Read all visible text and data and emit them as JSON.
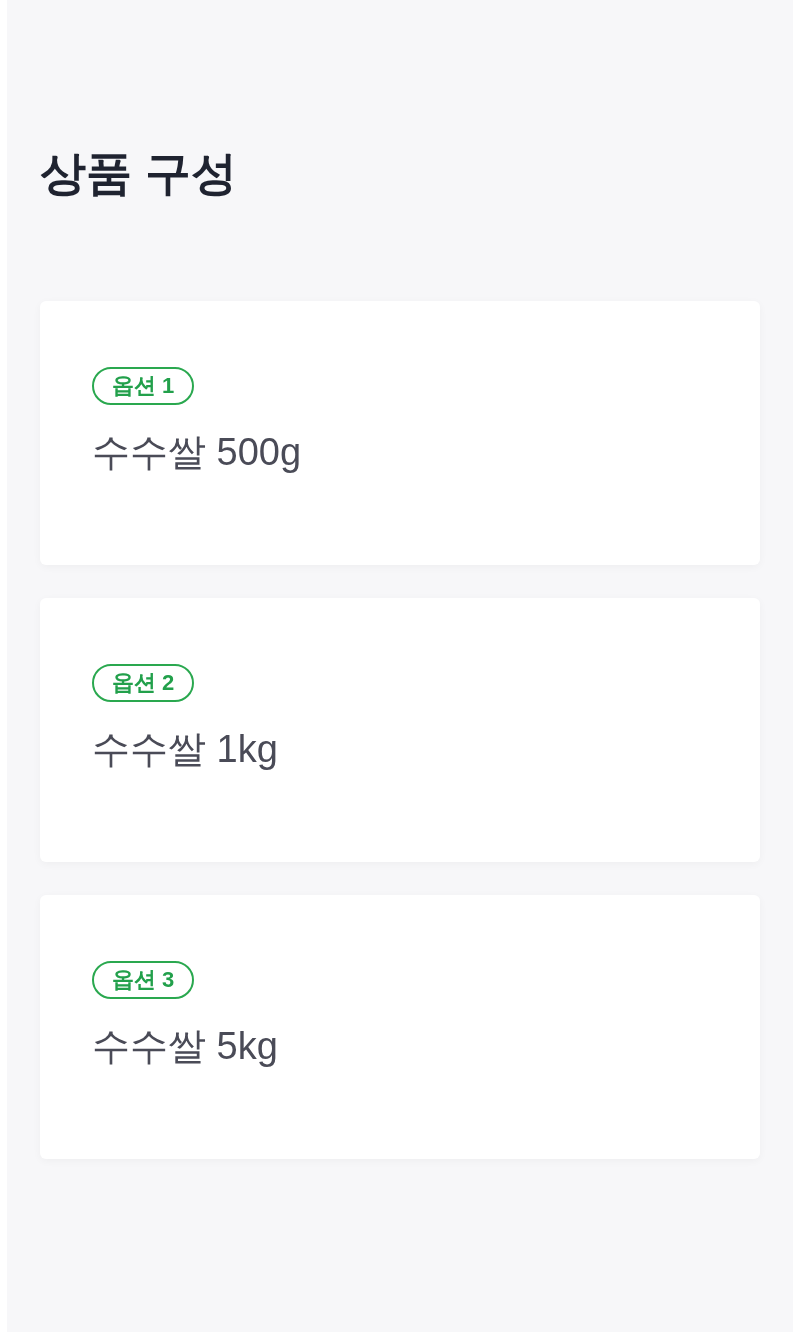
{
  "title": "상품 구성",
  "options": [
    {
      "badge": "옵션 1",
      "name": "수수쌀 500g"
    },
    {
      "badge": "옵션 2",
      "name": "수수쌀 1kg"
    },
    {
      "badge": "옵션 3",
      "name": "수수쌀 5kg"
    }
  ]
}
